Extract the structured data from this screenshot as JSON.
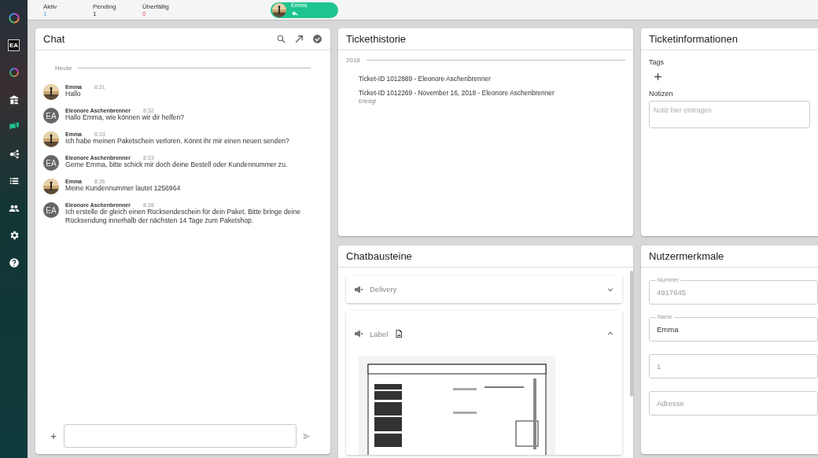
{
  "sidebar": {
    "badge": "EA",
    "items": [
      {
        "kind": "dashboard",
        "selected": false
      },
      {
        "kind": "chat",
        "selected": true
      },
      {
        "kind": "share",
        "selected": false
      },
      {
        "kind": "list",
        "selected": false
      },
      {
        "kind": "people",
        "selected": false
      },
      {
        "kind": "settings",
        "selected": false
      },
      {
        "kind": "help",
        "selected": false
      }
    ]
  },
  "top_bar": {
    "stats": [
      {
        "label": "Aktiv",
        "value": "1",
        "kind": "active"
      },
      {
        "label": "Pending",
        "value": "1",
        "kind": "pending"
      },
      {
        "label": "Überfällig",
        "value": "0",
        "kind": "overdue"
      }
    ],
    "active_chat": {
      "name": "Emma"
    }
  },
  "chat": {
    "title": "Chat",
    "day": "Heute",
    "messages": [
      {
        "kind": "customer",
        "sender": "Emma",
        "time": "8:31",
        "text": "Hallo"
      },
      {
        "kind": "agent",
        "initials": "EA",
        "sender": "Eleonore Aschenbrenner",
        "time": "8:32",
        "text": "Hallo Emma, wie können wir dir helfen?"
      },
      {
        "kind": "customer",
        "sender": "Emma",
        "time": "8:33",
        "text": "Ich habe meinen Paketschein verloren. Könnt ihr mir einen neuen senden?"
      },
      {
        "kind": "agent",
        "initials": "EA",
        "sender": "Eleonore Aschenbrenner",
        "time": "8:33",
        "text": "Gerne Emma, bitte schick mir doch deine Bestell oder Kundennummer zu."
      },
      {
        "kind": "customer",
        "sender": "Emma",
        "time": "8:36",
        "text": "Meine Kundennummer lautet 1256964"
      },
      {
        "kind": "agent",
        "initials": "EA",
        "sender": "Eleonore Aschenbrenner",
        "time": "8:38",
        "text": "Ich erstelle dir gleich einen Rücksendeschein für dein Paket. Bitte bringe deine Rücksendung innerhalb der nächsten 14 Tage zum Paketshop."
      }
    ]
  },
  "ticket_history": {
    "title": "Tickethistorie",
    "year": "2018",
    "tickets": [
      {
        "title": "Ticket-ID 1012889 - Eleonore Aschenbrenner"
      },
      {
        "title": "Ticket-ID 1012269 - November 16, 2018 - Eleonore Aschenbrenner",
        "status": "Erledigt"
      }
    ]
  },
  "chat_blocks": {
    "title": "Chatbausteine",
    "items": [
      {
        "label": "Delivery",
        "expanded": false,
        "attachment": false
      },
      {
        "label": "Label",
        "expanded": true,
        "attachment": true
      }
    ]
  },
  "ticket_info": {
    "title": "Ticketinformationen",
    "tags_label": "Tags",
    "notes_label": "Notizen",
    "notes": {
      "placeholder": "Notiz hier eintragen"
    }
  },
  "user_attributes": {
    "title": "Nutzermerkmale",
    "fields": [
      {
        "label": "Nummer",
        "value": "4917645",
        "disabled": true
      },
      {
        "label": "Name",
        "value": "Emma",
        "disabled": false
      },
      {
        "placeholder": "1"
      },
      {
        "placeholder": "Adresse"
      }
    ]
  }
}
